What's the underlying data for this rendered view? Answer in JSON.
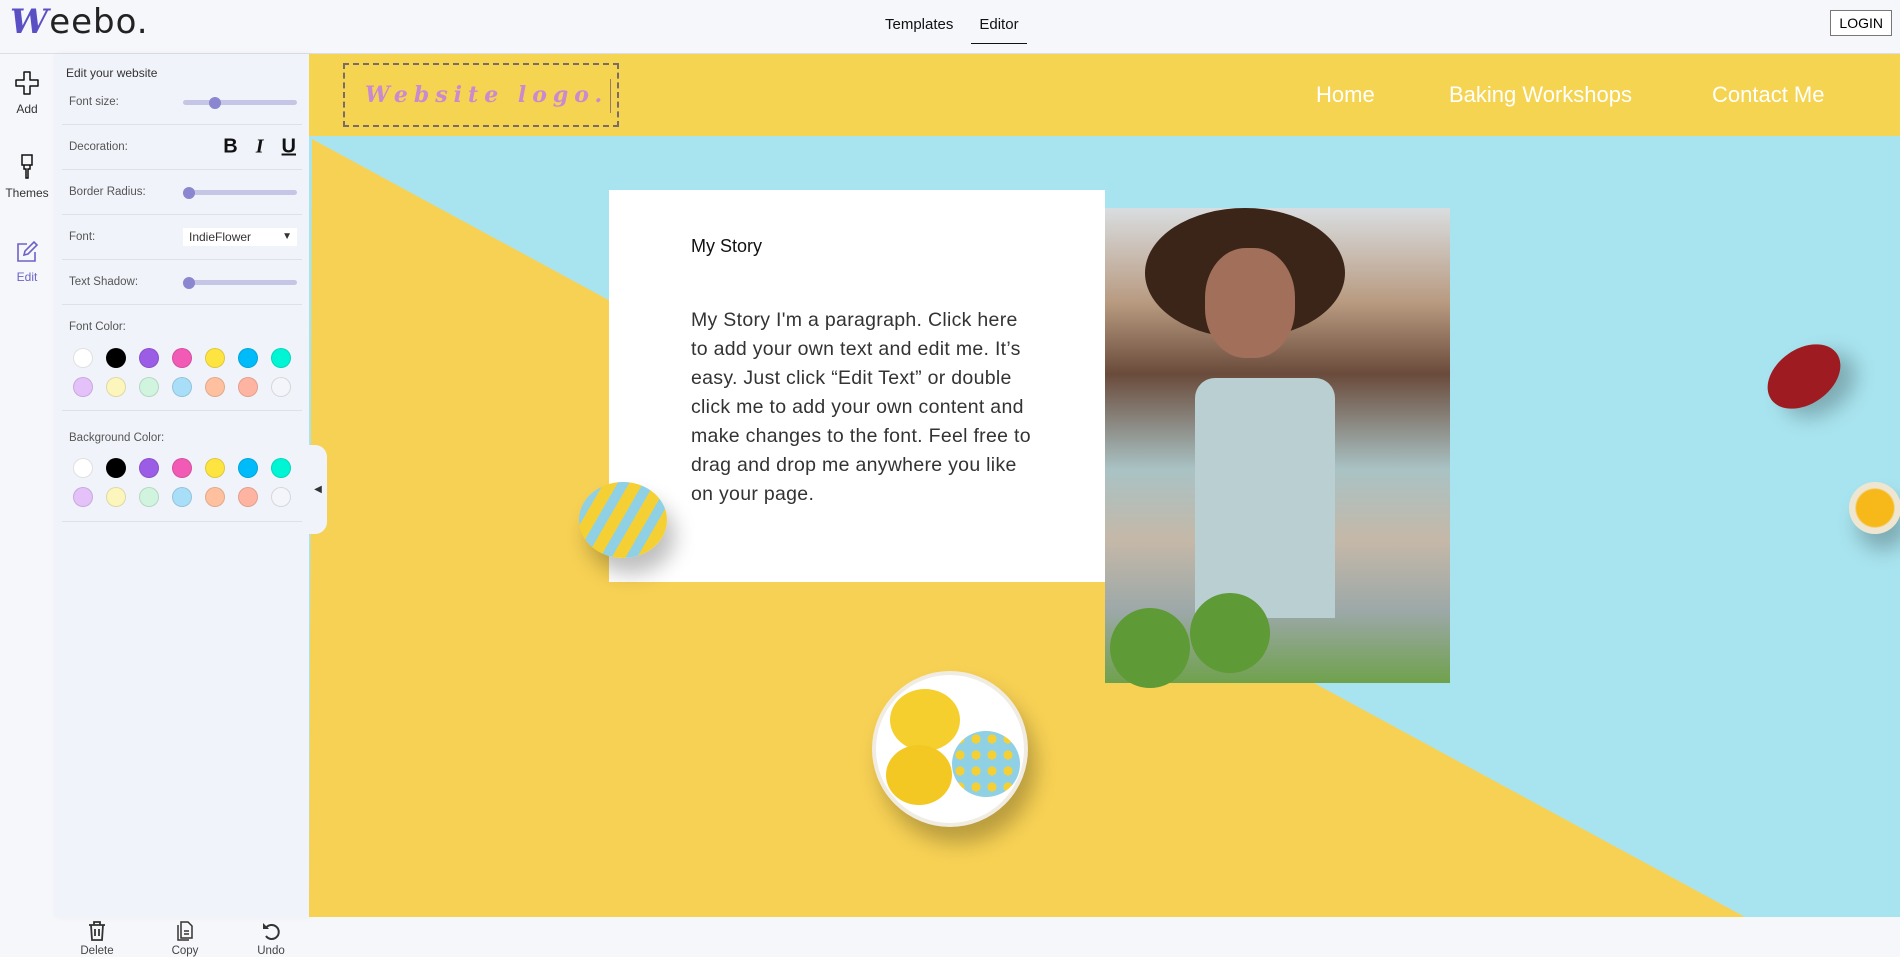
{
  "app": {
    "brand_initial": "W",
    "brand_rest": "eebo.",
    "tabs": [
      "Templates",
      "Editor"
    ],
    "active_tab": "Editor",
    "login_label": "LOGIN"
  },
  "rail": {
    "items": [
      {
        "label": "Add",
        "icon": "plus-icon"
      },
      {
        "label": "Themes",
        "icon": "paintbrush-icon"
      },
      {
        "label": "Edit",
        "icon": "edit-icon",
        "active": true
      }
    ]
  },
  "panel": {
    "title": "Edit your website",
    "font_size": {
      "label": "Font size:",
      "value": 0.25
    },
    "decoration": {
      "label": "Decoration:",
      "bold": "B",
      "italic": "I",
      "underline": "U"
    },
    "border_radius": {
      "label": "Border Radius:",
      "value": 0.0
    },
    "font": {
      "label": "Font:",
      "value": "IndieFlower"
    },
    "text_shadow": {
      "label": "Text Shadow:",
      "value": 0.0
    },
    "font_color": {
      "label": "Font Color:"
    },
    "background_color": {
      "label": "Background Color:"
    },
    "palette": [
      "#ffffff",
      "#000000",
      "#9b5de5",
      "#f15bb5",
      "#fee440",
      "#00bbf9",
      "#00f5d4",
      "#e4c1f9",
      "#fcf6bd",
      "#d0f4de",
      "#a9def9",
      "#ffc09f",
      "#ffb4a2",
      "#f4f5fa"
    ],
    "actions": [
      {
        "label": "Delete",
        "icon": "trash-icon"
      },
      {
        "label": "Copy",
        "icon": "copy-icon"
      },
      {
        "label": "Undo",
        "icon": "undo-icon"
      }
    ]
  },
  "site": {
    "logo": "Website logo.",
    "nav": [
      "Home",
      "Baking Workshops",
      "Contact Me"
    ],
    "story_title": "My Story",
    "story_text": "My Story I'm a paragraph. Click here to add your own text and edit me. It’s easy. Just click “Edit Text” or double click me to add your own content and make changes to the font. Feel free to drag and drop me anywhere you like on your page.",
    "colors": {
      "yellow": "#f7d154",
      "cyan": "#a8e4ef",
      "accent": "#6c63c7"
    }
  }
}
